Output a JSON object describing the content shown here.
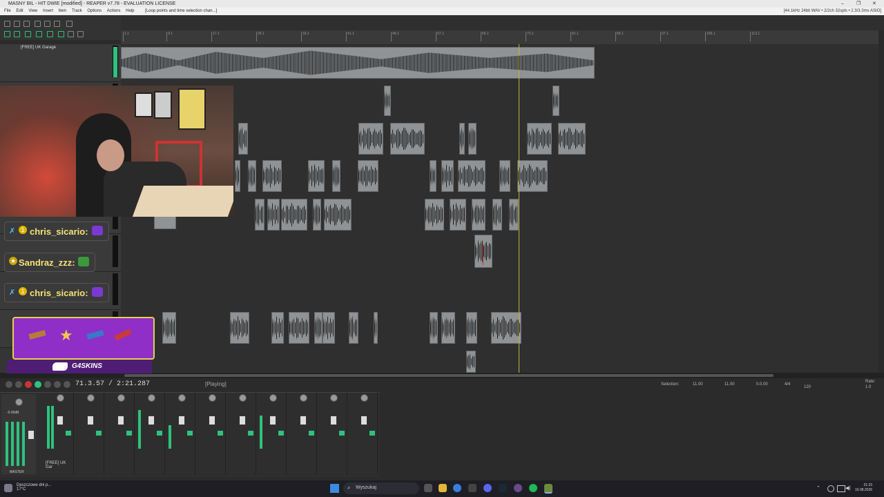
{
  "window": {
    "title": "MASNY BIL - HIT DWIE [modified] - REAPER v7.78 - EVALUATION LICENSE",
    "controls": [
      "–",
      "❐",
      "✕"
    ]
  },
  "menu": {
    "items": [
      "File",
      "Edit",
      "View",
      "Insert",
      "Item",
      "Track",
      "Options",
      "Actions",
      "Help"
    ],
    "hint": "[Loop points and time selection chan...]",
    "audio_info": "[44.1kHz 24bit WAV • 2/2ch 32spls • 2.3/3.3ms ASIO]"
  },
  "ruler": {
    "ticks": [
      "1.1",
      "9.1",
      "17.1",
      "25.1",
      "33.1",
      "41.1",
      "49.1",
      "57.1",
      "65.1",
      "73.1",
      "81.1",
      "89.1",
      "97.1",
      "105.1",
      "113.1"
    ]
  },
  "tracks": {
    "first_name": "[FREE] UK Garage"
  },
  "transport": {
    "time": "71.3.57 / 2:21.287",
    "state": "[Playing]"
  },
  "selection": {
    "label": "Selection:",
    "start": "11.00",
    "end": "11.00",
    "length": "0.0.00",
    "time_sig": "4/4",
    "bpm": "120",
    "rate_label": "Rate:",
    "rate": "1.0"
  },
  "mixer": {
    "master_label": "MASTER",
    "track_label": "[FREE] UK Gar",
    "master_volume": "-0.00dB"
  },
  "stream": {
    "chat": [
      {
        "name": "chris_sicario:"
      },
      {
        "name": "Sandraz_zzz:"
      },
      {
        "name": "chris_sicario:"
      }
    ],
    "promo_brand": "G4SKINS"
  },
  "taskbar": {
    "weather": "Deszczowe dni p...",
    "temp": "17°C",
    "search_placeholder": "Wyszukaj",
    "time": "21:23",
    "date": "16.08.2026"
  },
  "colors": {
    "meter_green": "#2ec27e",
    "edit_cursor": "#b8b34a",
    "item_gray": "#8f9396",
    "promo_purple": "#8f2fc8"
  }
}
